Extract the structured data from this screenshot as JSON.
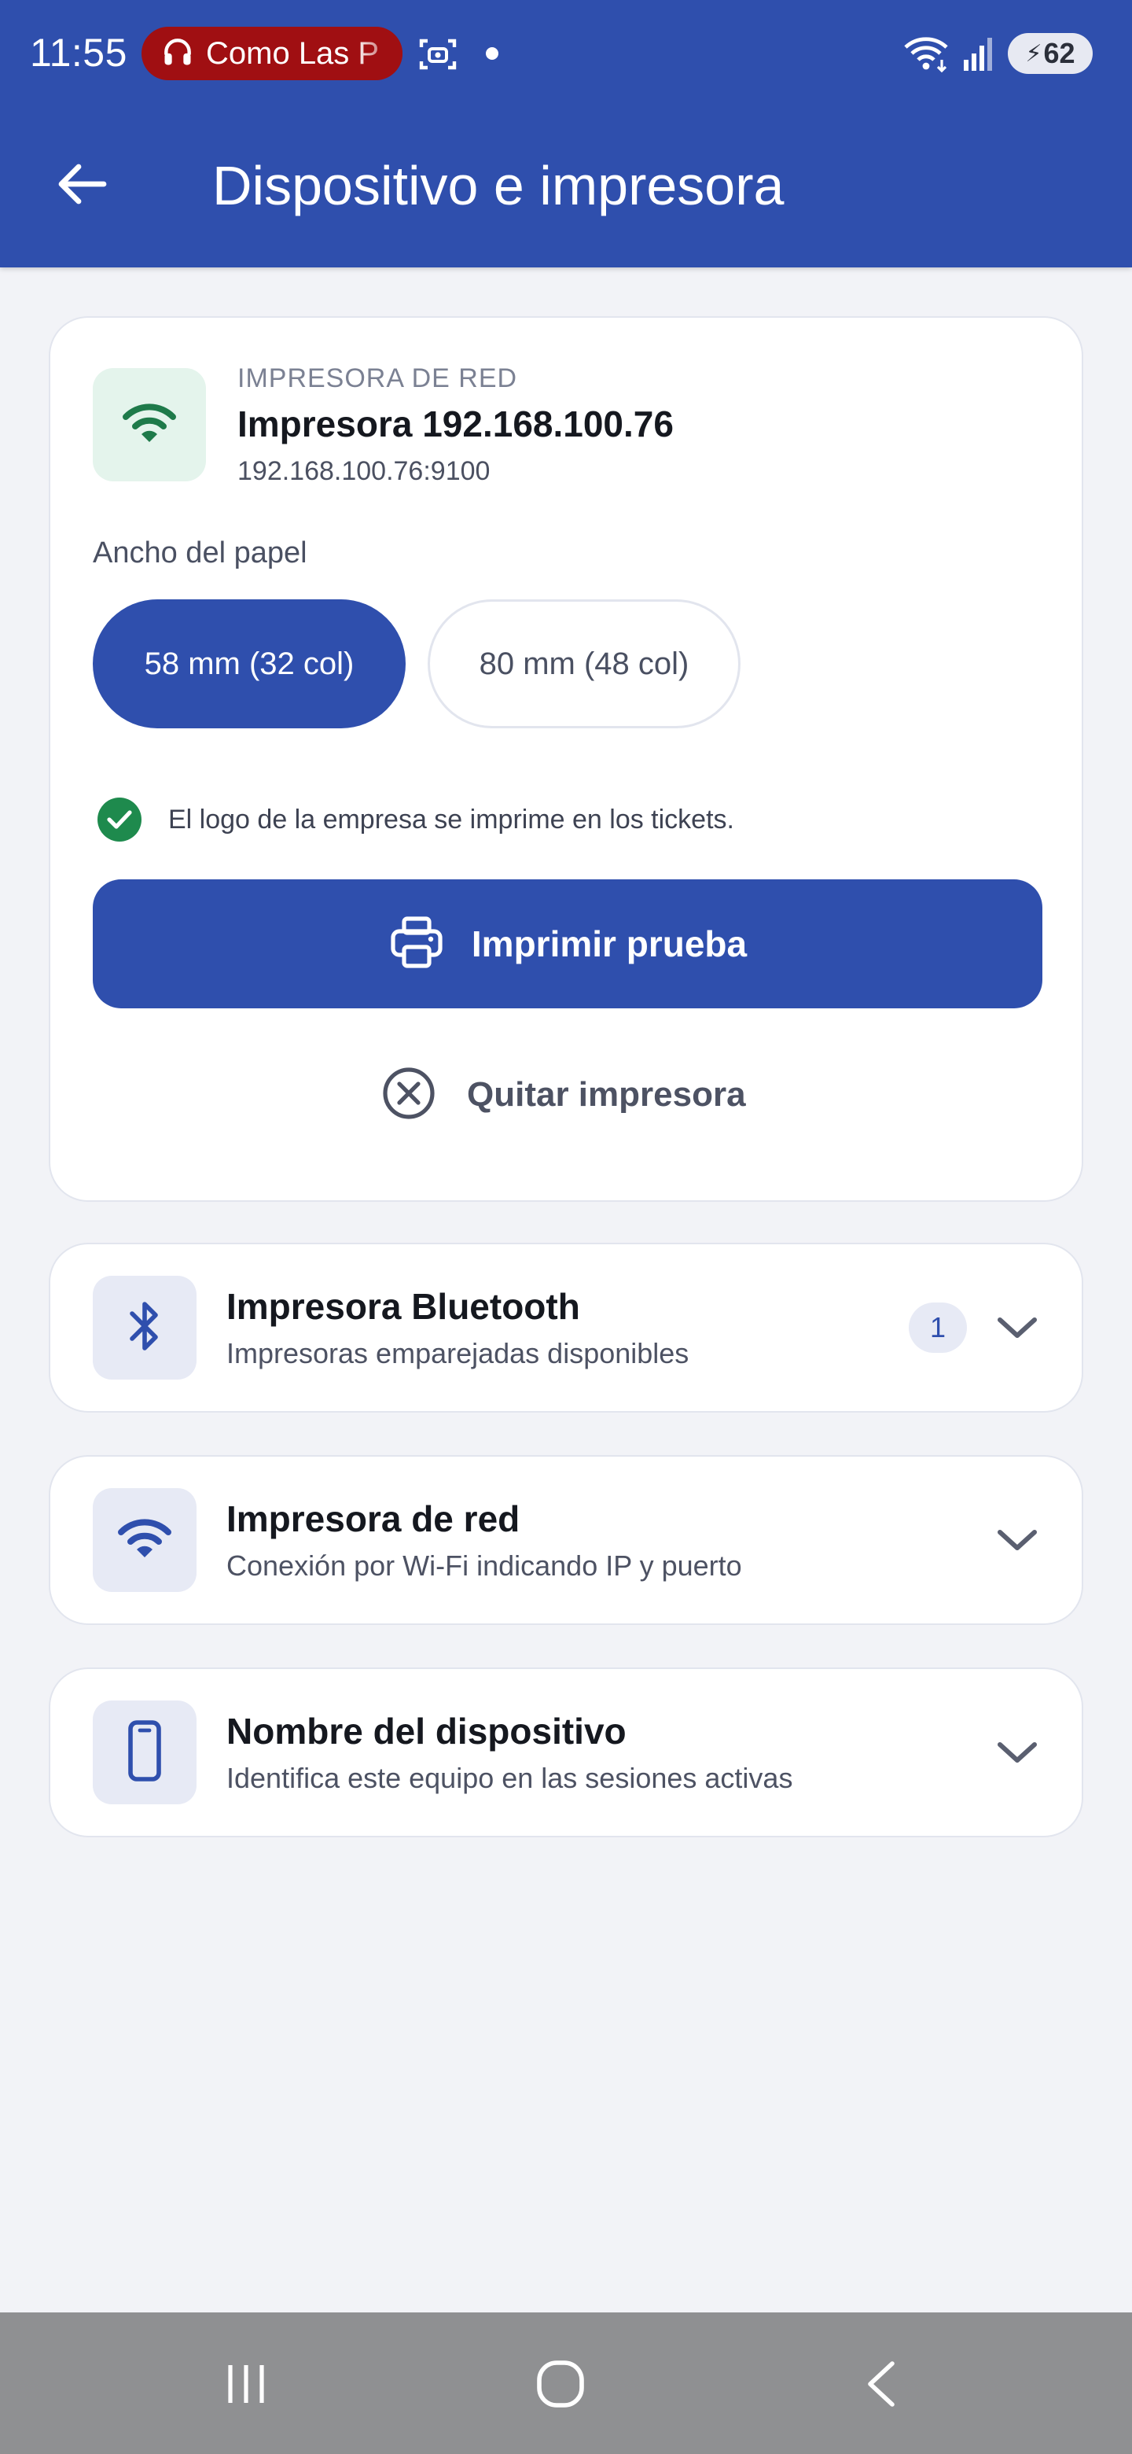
{
  "status_bar": {
    "time": "11:55",
    "media_text": "Como Las P",
    "battery": "62",
    "icons": [
      "headphones-icon",
      "screen-capture-icon",
      "notification-dot-icon",
      "wifi-icon",
      "cellular-signal-icon",
      "battery-charging-icon"
    ]
  },
  "app_bar": {
    "title": "Dispositivo e impresora",
    "back_icon": "arrow-left-icon"
  },
  "printer": {
    "type_label": "IMPRESORA DE RED",
    "name": "Impresora 192.168.100.76",
    "address": "192.168.100.76:9100",
    "icon": "wifi-icon",
    "icon_color": "#1e7a4a",
    "paper_width_label": "Ancho del papel",
    "paper_options": [
      {
        "label": "58 mm (32 col)",
        "selected": true
      },
      {
        "label": "80 mm (48 col)",
        "selected": false
      }
    ],
    "logo_note": "El logo de la empresa se imprime en los tickets.",
    "print_test_label": "Imprimir prueba",
    "remove_label": "Quitar impresora"
  },
  "sections": {
    "bluetooth": {
      "title": "Impresora Bluetooth",
      "subtitle": "Impresoras emparejadas disponibles",
      "badge": "1",
      "icon": "bluetooth-icon"
    },
    "network": {
      "title": "Impresora de red",
      "subtitle": "Conexión por Wi-Fi indicando IP y puerto",
      "icon": "wifi-icon"
    },
    "device": {
      "title": "Nombre del dispositivo",
      "subtitle": "Identifica este equipo en las sesiones activas",
      "icon": "phone-icon"
    }
  },
  "colors": {
    "primary": "#2f4fad",
    "success": "#1e8a4d",
    "background": "#f2f3f7",
    "media_pill": "#a00f12"
  },
  "nav_bar": {
    "icons": [
      "recents-icon",
      "home-icon",
      "back-icon"
    ]
  }
}
